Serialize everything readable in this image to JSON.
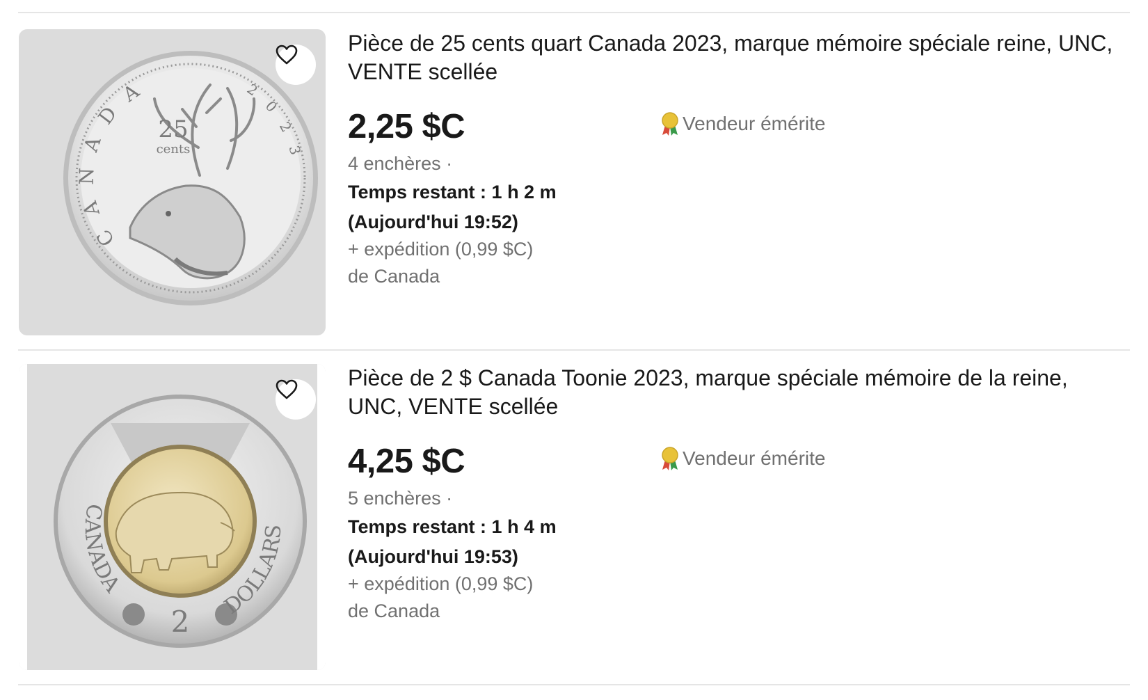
{
  "listings": [
    {
      "title": "Pièce de 25 cents quart Canada 2023, marque mémoire spéciale reine, UNC, VENTE scellée",
      "price": "2,25 $C",
      "bids": "4 enchères ·",
      "time_left": "Temps restant : 1 h 2 m",
      "end_time": "(Aujourd'hui 19:52)",
      "shipping": "+ expédition (0,99 $C)",
      "location": "de Canada",
      "seller_badge": "Vendeur émérite",
      "coin": {
        "denomination": "25",
        "unit": "cents",
        "country_letters": [
          "C",
          "A",
          "N",
          "A",
          "D",
          "A"
        ],
        "year_digits": [
          "2",
          "0",
          "2",
          "3"
        ]
      }
    },
    {
      "title": "Pièce de 2 $ Canada Toonie 2023, marque spéciale mémoire de la reine, UNC, VENTE scellée",
      "price": "4,25 $C",
      "bids": "5 enchères ·",
      "time_left": "Temps restant : 1 h 4 m",
      "end_time": "(Aujourd'hui 19:53)",
      "shipping": "+ expédition (0,99 $C)",
      "location": "de Canada",
      "seller_badge": "Vendeur émérite",
      "coin": {
        "denomination": "2",
        "left_legend": "CANADA",
        "right_legend": "DOLLARS"
      }
    }
  ],
  "icons": {
    "watch": "heart-icon",
    "badge": "award-ribbon-icon"
  },
  "colors": {
    "text_primary": "#191919",
    "text_secondary": "#707070",
    "thumb_bg": "#dcdcdc",
    "divider": "#e5e5e5",
    "badge_gold": "#e8c238"
  }
}
